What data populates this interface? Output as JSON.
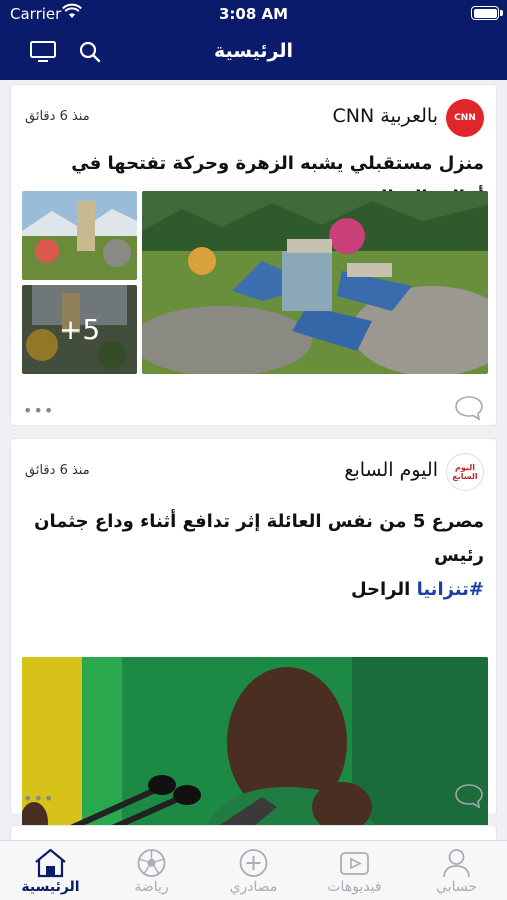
{
  "status": {
    "carrier": "Carrier",
    "time": "3:08 AM"
  },
  "header": {
    "title": "الرئيسية",
    "tv_icon": "tv-icon",
    "search_icon": "search-icon"
  },
  "feed": [
    {
      "source": "بالعربية CNN",
      "logo_text": "CNN",
      "time": "منذ 6 دقائق",
      "headline": "منزل مستقبلي يشبه الزهرة وحركة تفتحها في أعالي الجبال",
      "extra_images": "+5"
    },
    {
      "source": "اليوم السابع",
      "logo_text": "اليوم السابع",
      "time": "منذ 6 دقائق",
      "headline_line1": "مصرع 5 من نفس العائلة إثر تدافع أثناء وداع جثمان رئيس",
      "headline_tag": "#تنزانيا",
      "headline_rest": " الراحل"
    }
  ],
  "more_label": "•••",
  "tabs": [
    {
      "label": "حسابي",
      "icon": "person-icon"
    },
    {
      "label": "فيديوهات",
      "icon": "video-icon"
    },
    {
      "label": "مصادري",
      "icon": "plus-circle-icon"
    },
    {
      "label": "رياضة",
      "icon": "soccer-ball-icon"
    },
    {
      "label": "الرئيسية",
      "icon": "home-icon",
      "active": true
    }
  ],
  "colors": {
    "header": "#0b1b6b",
    "active_tab": "#0b1b6b",
    "hashtag": "#1a3fa8"
  }
}
